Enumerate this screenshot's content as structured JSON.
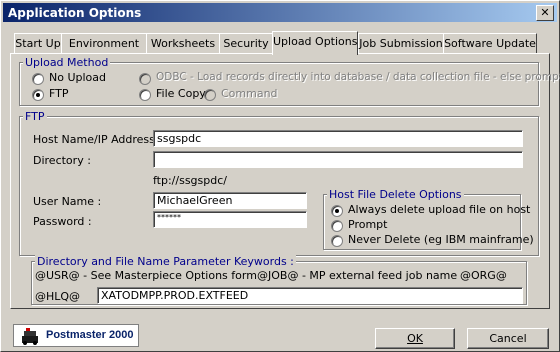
{
  "window": {
    "title": "Application Options",
    "close_glyph": "✕"
  },
  "tabs": [
    {
      "label": "Start Up",
      "active": false
    },
    {
      "label": "Environment",
      "active": false
    },
    {
      "label": "Worksheets",
      "active": false
    },
    {
      "label": "Security",
      "active": false
    },
    {
      "label": "Upload Options",
      "active": true
    },
    {
      "label": "Job Submission",
      "active": false
    },
    {
      "label": "Software Update",
      "active": false
    }
  ],
  "upload_method": {
    "legend": "Upload Method",
    "options": [
      {
        "label": "No Upload",
        "selected": false,
        "enabled": true
      },
      {
        "label": "FTP",
        "selected": true,
        "enabled": true
      },
      {
        "label": "ODBC - Load records directly into database / data collection file - else prompt",
        "selected": false,
        "enabled": false
      },
      {
        "label": "File Copy",
        "selected": false,
        "enabled": true
      },
      {
        "label": "Command",
        "selected": false,
        "enabled": false
      }
    ]
  },
  "ftp": {
    "legend": "FTP",
    "host_label": "Host Name/IP Address :",
    "host_value": "ssgspdc",
    "directory_label": "Directory :",
    "directory_value": "",
    "ftp_path": "ftp://ssgspdc/",
    "user_label": "User Name :",
    "user_value": "MichaelGreen",
    "password_label": "Password :",
    "password_value": "******"
  },
  "host_delete": {
    "legend": "Host File Delete Options",
    "options": [
      {
        "label": "Always delete upload file on host",
        "selected": true
      },
      {
        "label": "Prompt",
        "selected": false
      },
      {
        "label": "Never Delete (eg IBM mainframe)",
        "selected": false
      }
    ]
  },
  "keywords": {
    "legend": "Directory and File Name Parameter Keywords :",
    "usr": "@USR@ - See Masterpiece Options form",
    "job": "@JOB@ - MP external feed job name",
    "org": "@ORG@",
    "hlq_label": "@HLQ@",
    "hlq_value": "XATODMPP.PROD.EXTFEED"
  },
  "footer": {
    "logo_text": "Postmaster 2000",
    "ok_label": "OK",
    "cancel_label": "Cancel"
  },
  "colors": {
    "titlebar_start": "#0a246a",
    "titlebar_end": "#a6caf0",
    "legend": "#00008b"
  }
}
